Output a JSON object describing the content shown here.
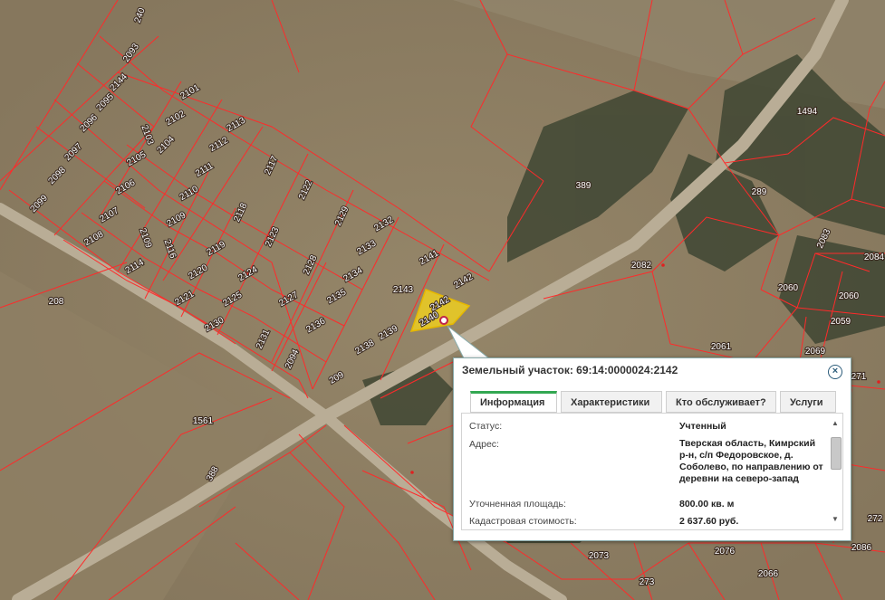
{
  "map": {
    "plot_labels": [
      [
        "240"
      ],
      [
        "2093"
      ],
      [
        "2144"
      ],
      [
        "2095"
      ],
      [
        "2096"
      ],
      [
        "2097"
      ],
      [
        "2098"
      ],
      [
        "2099"
      ],
      [
        "2101"
      ],
      [
        "2102"
      ],
      [
        "2103"
      ],
      [
        "2104"
      ],
      [
        "2105"
      ],
      [
        "2106"
      ],
      [
        "2107"
      ],
      [
        "2108"
      ],
      [
        "2114"
      ],
      [
        "2113"
      ],
      [
        "2112"
      ],
      [
        "2111"
      ],
      [
        "2110"
      ],
      [
        "2109"
      ],
      [
        "2109"
      ],
      [
        "2116"
      ],
      [
        "2117"
      ],
      [
        "2118"
      ],
      [
        "2119"
      ],
      [
        "2120"
      ],
      [
        "2121"
      ],
      [
        "2122"
      ],
      [
        "2123"
      ],
      [
        "2124"
      ],
      [
        "2125"
      ],
      [
        "2130"
      ],
      [
        "2129"
      ],
      [
        "2128"
      ],
      [
        "2127"
      ],
      [
        "2131"
      ],
      [
        "2132"
      ],
      [
        "2133"
      ],
      [
        "2134"
      ],
      [
        "2135"
      ],
      [
        "2136"
      ],
      [
        "2094"
      ],
      [
        "2141"
      ],
      [
        "2143"
      ],
      [
        "2142"
      ],
      [
        "2142"
      ],
      [
        "2140"
      ],
      [
        "2139"
      ],
      [
        "2138"
      ],
      [
        "209"
      ],
      [
        "208"
      ],
      [
        "1561"
      ],
      [
        "388"
      ],
      [
        "389"
      ],
      [
        "1494"
      ],
      [
        "289"
      ],
      [
        "2082"
      ],
      [
        "2083"
      ],
      [
        "2060"
      ],
      [
        "2060"
      ],
      [
        "2059"
      ],
      [
        "2084"
      ],
      [
        "2061"
      ],
      [
        "2069"
      ],
      [
        "271"
      ],
      [
        "272"
      ],
      [
        "2086"
      ],
      [
        "2073"
      ],
      [
        "2076"
      ],
      [
        "2066"
      ],
      [
        "273"
      ]
    ]
  },
  "popup": {
    "title": "Земельный участок: 69:14:0000024:2142",
    "close_icon": "close-icon",
    "tabs": [
      "Информация",
      "Характеристики",
      "Кто обслуживает?",
      "Услуги"
    ],
    "active_tab": "Информация",
    "fields": [
      {
        "label": "Статус:",
        "value": "Учтенный"
      },
      {
        "label": "Адрес:",
        "value": "Тверская область, Кимрский р-н, с/п Федоровское, д. Соболево, по направлению от деревни на северо-запад"
      },
      {
        "label": "Уточненная площадь:",
        "value": "800.00 кв. м"
      },
      {
        "label": "Кадастровая стоимость:",
        "value": "2 637.60 руб."
      }
    ]
  },
  "colors": {
    "parcel_border": "#ff2a2a",
    "selected_fill": "#f2d21b",
    "tab_active": "#33a852",
    "road": "#b9ad96"
  }
}
